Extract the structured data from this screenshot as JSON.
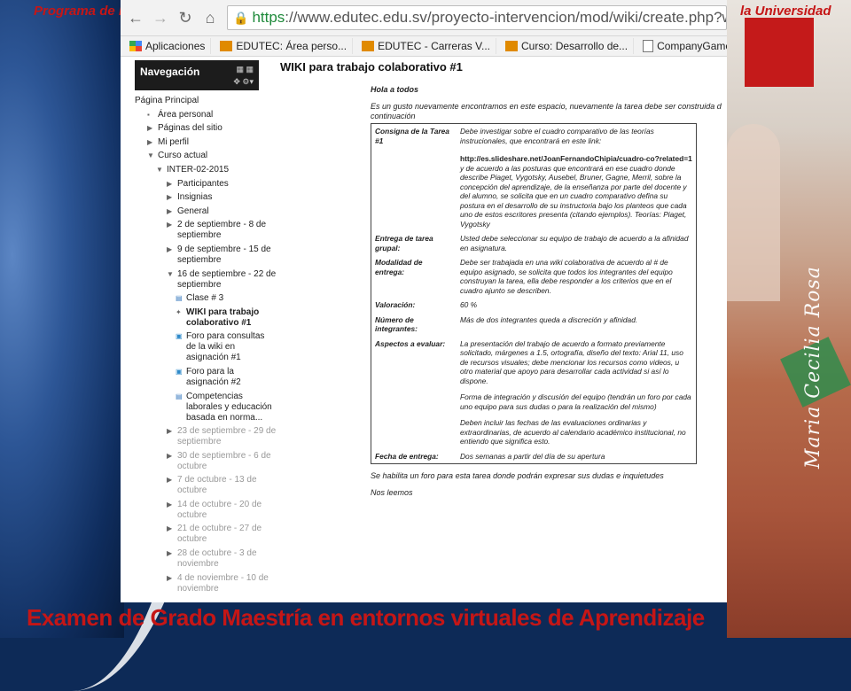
{
  "slide": {
    "top_left_text": "Programa de F",
    "top_right_text": "la Universidad",
    "bottom_title": "Examen de Grado Maestría en entornos virtuales de Aprendizaje",
    "signature": "Maria Cecilia Rosa"
  },
  "browser": {
    "url_https": "https",
    "url_rest": "://www.edutec.edu.sv/proyecto-intervencion/mod/wiki/create.php?wid=",
    "bookmarks": [
      {
        "label": "Aplicaciones",
        "icon": "apps-grid-icon"
      },
      {
        "label": "EDUTEC: Área perso...",
        "icon": "moodle-icon"
      },
      {
        "label": "EDUTEC - Carreras V...",
        "icon": "moodle-icon"
      },
      {
        "label": "Curso: Desarrollo de...",
        "icon": "moodle-icon"
      },
      {
        "label": "CompanyGame: sim...",
        "icon": "page-icon"
      }
    ]
  },
  "navigation": {
    "title": "Navegación",
    "items": [
      {
        "label": "Página Principal",
        "level": 0,
        "arrow": ""
      },
      {
        "label": "Área personal",
        "level": 1,
        "arrow": "bullet"
      },
      {
        "label": "Páginas del sitio",
        "level": 1,
        "arrow": "right"
      },
      {
        "label": "Mi perfil",
        "level": 1,
        "arrow": "right"
      },
      {
        "label": "Curso actual",
        "level": 1,
        "arrow": "down"
      },
      {
        "label": "INTER-02-2015",
        "level": 2,
        "arrow": "down"
      },
      {
        "label": "Participantes",
        "level": 3,
        "arrow": "right"
      },
      {
        "label": "Insignias",
        "level": 3,
        "arrow": "right"
      },
      {
        "label": "General",
        "level": 3,
        "arrow": "right"
      },
      {
        "label": "2 de septiembre - 8 de septiembre",
        "level": 3,
        "arrow": "right"
      },
      {
        "label": "9 de septiembre - 15 de septiembre",
        "level": 3,
        "arrow": "right"
      },
      {
        "label": "16 de septiembre - 22 de septiembre",
        "level": 3,
        "arrow": "down"
      },
      {
        "label": "Clase # 3",
        "level": 4,
        "arrow": "page"
      },
      {
        "label": "WIKI para trabajo colaborativo #1",
        "level": 4,
        "arrow": "wiki",
        "bold": true
      },
      {
        "label": "Foro para consultas de la wiki en asignación #1",
        "level": 4,
        "arrow": "forum"
      },
      {
        "label": "Foro para la asignación #2",
        "level": 4,
        "arrow": "forum"
      },
      {
        "label": "Competencias laborales y educación basada en norma...",
        "level": 4,
        "arrow": "page"
      },
      {
        "label": "23 de septiembre - 29 de septiembre",
        "level": 3,
        "arrow": "right",
        "muted": true
      },
      {
        "label": "30 de septiembre - 6 de octubre",
        "level": 3,
        "arrow": "right",
        "muted": true
      },
      {
        "label": "7 de octubre - 13 de octubre",
        "level": 3,
        "arrow": "right",
        "muted": true
      },
      {
        "label": "14 de octubre - 20 de octubre",
        "level": 3,
        "arrow": "right",
        "muted": true
      },
      {
        "label": "21 de octubre - 27 de octubre",
        "level": 3,
        "arrow": "right",
        "muted": true
      },
      {
        "label": "28 de octubre - 3 de noviembre",
        "level": 3,
        "arrow": "right",
        "muted": true
      },
      {
        "label": "4 de noviembre - 10 de noviembre",
        "level": 3,
        "arrow": "right",
        "muted": true
      }
    ]
  },
  "page": {
    "title": "WIKI para trabajo colaborativo #1",
    "greeting": "Hola a todos",
    "intro_line1": "Es un gusto nuevamente encontramos  en este espacio, nuevamente la tarea debe ser construida d",
    "intro_line2": "continuación",
    "rows": [
      {
        "key": "Consigna de la Tarea #1",
        "value": "Debe investigar  sobre el cuadro comparativo de las teorías instrucionales, que encontrará en este link:",
        "url": "http://es.slideshare.net/JoanFernandoChipia/cuadro-co?related=1",
        "value2": "y de acuerdo a las posturas que encontrará en ese cuadro donde describe Piaget, Vygotsky, Ausebel, Bruner, Gagne, Merril,  sobre la concepción  del aprendizaje, de la enseñanza  por parte del docente y del alumno, se solicita que en un cuadro  comparativo defina su postura en el  desarrollo de su  instructoria bajo los planteos que cada uno de estos escritores presenta (citando ejemplos). Teorías: Piaget, Vygotsky"
      },
      {
        "key": "Entrega de tarea grupal:",
        "value": "Usted debe seleccionar su equipo de trabajo de acuerdo a la afinidad en asignatura."
      },
      {
        "key": "Modalidad de entrega:",
        "value": "Debe ser trabajada en  una wiki colaborativa de acuerdo al # de equipo asignado, se solicita que todos los integrantes del equipo construyan la tarea, ella debe responder a los criterios que en el cuadro ajunto se describen."
      },
      {
        "key": "Valoración:",
        "value": "60 %"
      },
      {
        "key": "Número de integrantes:",
        "value": "Más de dos integrantes queda a discreción  y afinidad."
      },
      {
        "key": "Aspectos a evaluar:",
        "value": "La presentación del trabajo de acuerdo a formato previamente solicitado, márgenes a 1.5, ortografía, diseño del texto: Arial  11, uso de recursos visuales;  debe mencionar los  recursos como videos,  u otro material que apoyo para desarrollar cada actividad si así lo dispone.",
        "value2": "Forma de integración y discusión del equipo (tendrán un foro por cada uno  equipo para  sus dudas  o para la realización del mismo)",
        "value3": "Deben incluir las fechas de las evaluaciones ordinarias y extraordinarias, de acuerdo al calendario académico institucional, no entiendo que significa esto."
      },
      {
        "key": "Fecha de entrega:",
        "value": "Dos semanas a partir del día de su apertura"
      }
    ],
    "footer1": "Se habilita un foro para esta tarea  donde podrán expresar sus dudas e inquietudes",
    "footer2": "Nos leemos"
  }
}
